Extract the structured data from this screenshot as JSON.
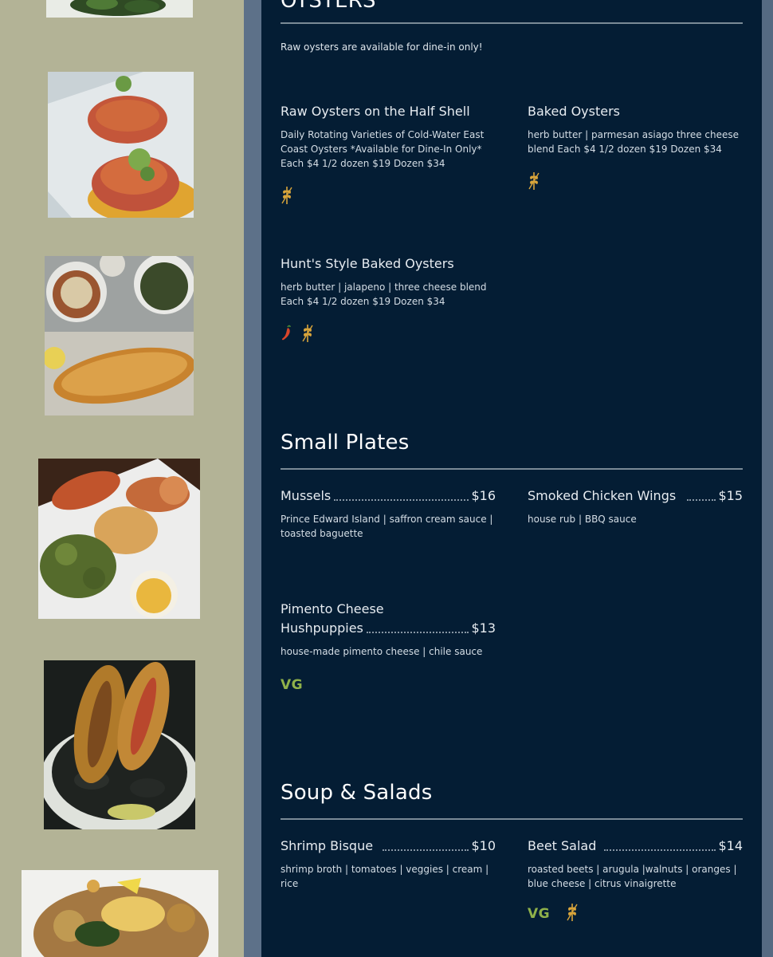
{
  "sections": {
    "oysters": {
      "title": "OYSTERS",
      "note": "Raw oysters are available for dine-in only!",
      "items": [
        {
          "name": "Raw Oysters on the Half Shell",
          "desc": "Daily Rotating Varieties of Cold-Water East Coast Oysters *Available for Dine-In Only* Each $4 1/2 dozen $19 Dozen $34",
          "icons": [
            "gluten-free-icon"
          ]
        },
        {
          "name": "Baked Oysters",
          "desc": "herb butter | parmesan asiago three cheese blend Each $4 1/2 dozen $19 Dozen $34",
          "icons": [
            "gluten-free-icon"
          ]
        },
        {
          "name": "Hunt's Style Baked Oysters",
          "desc": "herb butter | jalapeno | three cheese blend Each $4 1/2 dozen $19 Dozen $34",
          "icons": [
            "spicy-pepper-icon",
            "gluten-free-icon"
          ]
        }
      ]
    },
    "small_plates": {
      "title": "Small Plates",
      "items": [
        {
          "name": "Mussels",
          "price": "$16",
          "desc": "Prince Edward Island | saffron cream sauce | toasted baguette"
        },
        {
          "name": "Smoked Chicken Wings",
          "price": "$15",
          "desc": "house rub | BBQ sauce"
        },
        {
          "name_line1": "Pimento Cheese",
          "name_line2": "Hushpuppies",
          "price": "$13",
          "desc": "house-made pimento cheese | chile sauce",
          "badge": "VG"
        }
      ]
    },
    "soup_salads": {
      "title": "Soup & Salads",
      "items": [
        {
          "name": "Shrimp Bisque",
          "price": "$10",
          "desc": "shrimp broth | tomatoes | veggies | cream | rice"
        },
        {
          "name": "Beet Salad",
          "price": "$14",
          "desc": "roasted beets | arugula |walnuts | oranges | blue cheese | citrus vinaigrette",
          "badge": "VG"
        }
      ]
    }
  },
  "colors": {
    "panel_bg": "#041d34",
    "rail_bg": "#b3b396",
    "gluten_free_icon": "#d9a53b",
    "spicy_icon": "#d9452a",
    "vegetarian_badge": "#8fb14a"
  }
}
